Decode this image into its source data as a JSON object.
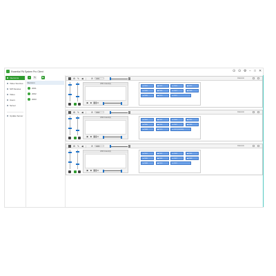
{
  "app": {
    "title": "Essential PA System Pro Client",
    "controls": [
      "⊙",
      "⊙",
      "⚙",
      "−",
      "□",
      "✕"
    ]
  },
  "sidebar": {
    "items": [
      {
        "label": "Intercoms",
        "active": true
      },
      {
        "label": "Video Sources",
        "active": false
      },
      {
        "label": "SIP Devices",
        "active": false
      },
      {
        "label": "Video",
        "active": false
      },
      {
        "label": "Users",
        "active": false
      },
      {
        "label": "Server",
        "active": false
      },
      {
        "label": "Update Server",
        "active": false
      }
    ]
  },
  "panel2": {
    "toolbar": {
      "add": "+",
      "edit": "✎",
      "go": "▶"
    },
    "rows": [
      {
        "label": "Intercom"
      },
      {
        "label": "2001"
      },
      {
        "label": "2002"
      },
      {
        "label": "2003"
      }
    ]
  },
  "cards": [
    {
      "field": "1001",
      "name": "Intercom",
      "media_title": "2001 Grand(1)",
      "tiles": [
        {
          "label": "2001"
        },
        {
          "label": "2002"
        },
        {
          "label": "2003"
        },
        {
          "label": "2004"
        },
        {
          "label": "2005"
        },
        {
          "label": "2006"
        },
        {
          "label": "2007"
        },
        {
          "label": "2008"
        },
        {
          "label": "2009"
        },
        {
          "label": "2010"
        },
        {
          "label": "2011"
        }
      ]
    },
    {
      "field": "1002",
      "name": "Intercom",
      "media_title": "2002 Grand(1)",
      "tiles": [
        {
          "label": "2001"
        },
        {
          "label": "2002"
        },
        {
          "label": "2003"
        },
        {
          "label": "2004"
        },
        {
          "label": "2005"
        },
        {
          "label": "2006"
        },
        {
          "label": "2007"
        },
        {
          "label": "2008"
        },
        {
          "label": "2009"
        },
        {
          "label": "2010"
        },
        {
          "label": "2011 (0:00:00)"
        }
      ]
    },
    {
      "field": "1003",
      "name": "Intercom",
      "media_title": "2003 Grand(1)",
      "tiles": [
        {
          "label": "2001"
        },
        {
          "label": "2002"
        },
        {
          "label": "2003"
        },
        {
          "label": "2004"
        },
        {
          "label": "2005"
        },
        {
          "label": "2006"
        },
        {
          "label": "2007"
        },
        {
          "label": "2008"
        },
        {
          "label": "2009"
        },
        {
          "label": "2010"
        },
        {
          "label": "2011"
        }
      ]
    }
  ],
  "colors": {
    "accent_green": "#2e9a2e",
    "tile_blue": "#6ea3ea",
    "tile_border": "#3f78c8",
    "knob_blue": "#1e72c8",
    "scrollbar": "#4fc8c0"
  }
}
